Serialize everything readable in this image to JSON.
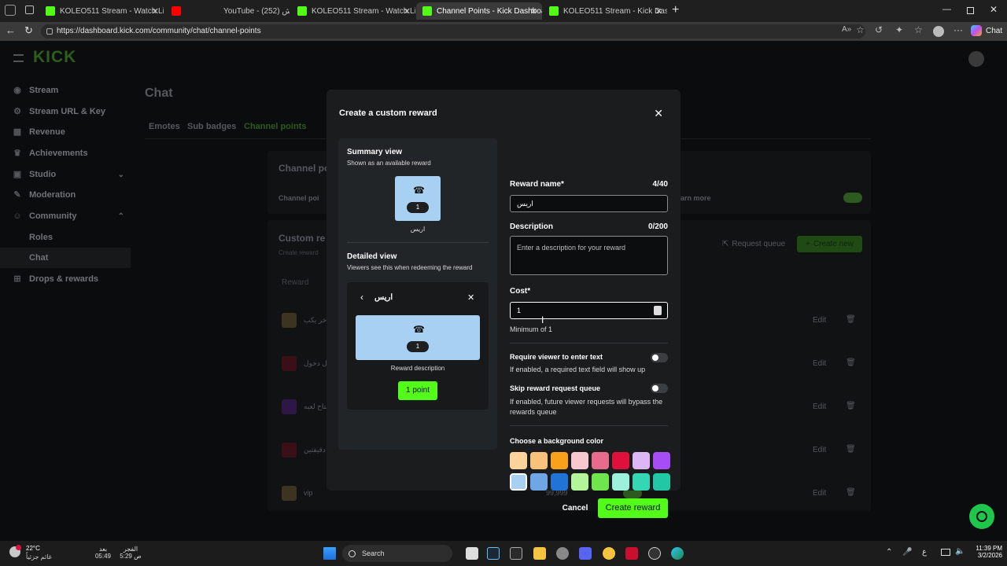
{
  "browser": {
    "tabs": [
      {
        "label": "KOLEO511 Stream - Watch Live on",
        "color": "#53fc18",
        "active": false
      },
      {
        "label": "YouTube - كدش (252)",
        "color": "#ff0000",
        "active": false
      },
      {
        "label": "KOLEO511 Stream - Watch Live on",
        "color": "#53fc18",
        "active": false
      },
      {
        "label": "Channel Points - Kick Dashboard",
        "color": "#53fc18",
        "active": true
      },
      {
        "label": "KOLEO511 Stream - Kick Dashboar",
        "color": "#53fc18",
        "active": false
      }
    ],
    "url": "https://dashboard.kick.com/community/chat/channel-points",
    "copilot_label": "Chat"
  },
  "sidebar": {
    "logo": "KICK",
    "items": [
      {
        "label": "Stream",
        "icon": "radio-icon"
      },
      {
        "label": "Stream URL & Key",
        "icon": "gear-icon"
      },
      {
        "label": "Revenue",
        "icon": "chart-icon"
      },
      {
        "label": "Achievements",
        "icon": "trophy-icon"
      },
      {
        "label": "Studio",
        "icon": "studio-icon"
      },
      {
        "label": "Moderation",
        "icon": "wrench-icon"
      },
      {
        "label": "Community",
        "icon": "people-icon"
      },
      {
        "label": "Roles",
        "icon": ""
      },
      {
        "label": "Chat",
        "icon": ""
      },
      {
        "label": "Drops & rewards",
        "icon": "gift-icon"
      }
    ]
  },
  "main": {
    "title": "Chat",
    "tabs": [
      "Emotes",
      "Sub badges",
      "Channel points"
    ],
    "section_title": "Channel po",
    "toggle_row_label": "Channel poi",
    "learn_more": "arn more",
    "custom_title": "Custom re",
    "custom_sub": "Create reward",
    "request_queue": "Request queue",
    "create_new": "Create new",
    "col_reward": "Reward",
    "rows": [
      {
        "name": "اخر يكب",
        "edit": "Edit"
      },
      {
        "name": "ل دخول",
        "edit": "Edit"
      },
      {
        "name": "فتاح لعبه",
        "edit": "Edit"
      },
      {
        "name": "ت دقيقتين",
        "edit": "Edit"
      },
      {
        "name": "vip",
        "cost": "99,999",
        "edit": "Edit"
      }
    ]
  },
  "modal": {
    "title": "Create a custom reward",
    "summary_title": "Summary view",
    "summary_sub": "Shown as an available reward",
    "summary_cost": "1",
    "summary_name": "اريس",
    "detailed_title": "Detailed view",
    "detailed_sub": "Viewers see this when redeeming the reward",
    "detail_name": "اريس",
    "detail_cost": "1",
    "detail_desc": "Reward description",
    "detail_button": "1 point",
    "reward_name_label": "Reward name*",
    "reward_name_count": "4/40",
    "reward_name_value": "اريس",
    "description_label": "Description",
    "description_count": "0/200",
    "description_placeholder": "Enter a description for your reward",
    "cost_label": "Cost*",
    "cost_value": "1",
    "cost_hint": "Minimum of 1",
    "require_label": "Require viewer to enter text",
    "require_desc": "If enabled, a required text field will show up",
    "skip_label": "Skip reward request queue",
    "skip_desc": "If enabled, future viewer requests will bypass the rewards queue",
    "color_label": "Choose a background color",
    "colors": [
      "#fdd39b",
      "#f8c27a",
      "#f9a11b",
      "#f9c7d0",
      "#e86b8c",
      "#e0103c",
      "#dcb6f5",
      "#a64df5",
      "#a8d0f2",
      "#6ea6e6",
      "#1f74d6",
      "#b5f59a",
      "#6fe64b",
      "#9cf0dc",
      "#34d6b3",
      "#22c7a5"
    ],
    "selected_color": 8,
    "cancel": "Cancel",
    "create": "Create reward"
  },
  "taskbar": {
    "weather": "22°C",
    "weather_sub": "غائم جزئياً",
    "prayer1_name": "بعد",
    "prayer1_time": "05:49",
    "prayer2_name": "الفجر",
    "prayer2_time": "5:29 ص",
    "search": "Search",
    "time": "11:39 PM",
    "date": "3/2/2026",
    "lang": "ع"
  }
}
